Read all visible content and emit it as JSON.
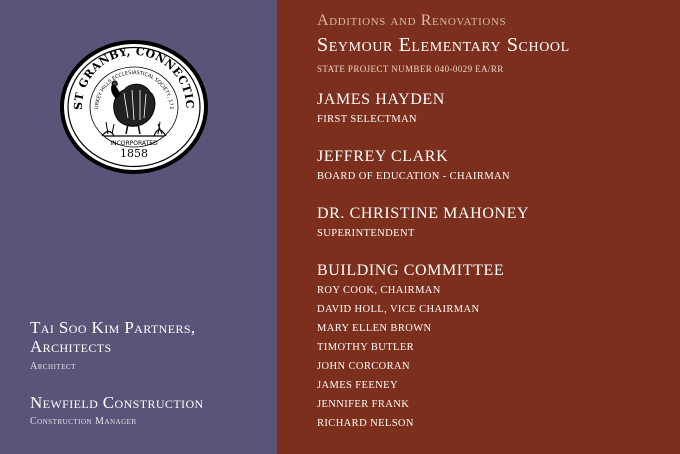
{
  "seal": {
    "ring_text": "EAST GRANBY, CONNECTICUT",
    "inner_text": "TURKEY HILLS ECCLESIASTICAL SOCIETY, 1736",
    "incorporated_label": "INCORPORATED",
    "incorporated_year": "1858"
  },
  "left": {
    "architect_name": "Tai Soo Kim Partners, Architects",
    "architect_role": "Architect",
    "contractor_name": "Newfield Construction",
    "contractor_role": "Construction Manager"
  },
  "right": {
    "subtitle": "Additions and Renovations",
    "title": "Seymour Elementary School",
    "project_number": "State Project number 040-0029 EA/RR",
    "officials": [
      {
        "name": "James Hayden",
        "role": "First Selectman"
      },
      {
        "name": "Jeffrey Clark",
        "role": "Board of Education - Chairman"
      },
      {
        "name": "Dr. Christine Mahoney",
        "role": "Superintendent"
      }
    ],
    "committee_heading": "Building Committee",
    "committee_members": [
      "Roy Cook, Chairman",
      "David Holl, Vice Chairman",
      "Mary Ellen Brown",
      "Timothy Butler",
      "John Corcoran",
      "James Feeney",
      "Jennifer Frank",
      "Richard Nelson"
    ]
  }
}
